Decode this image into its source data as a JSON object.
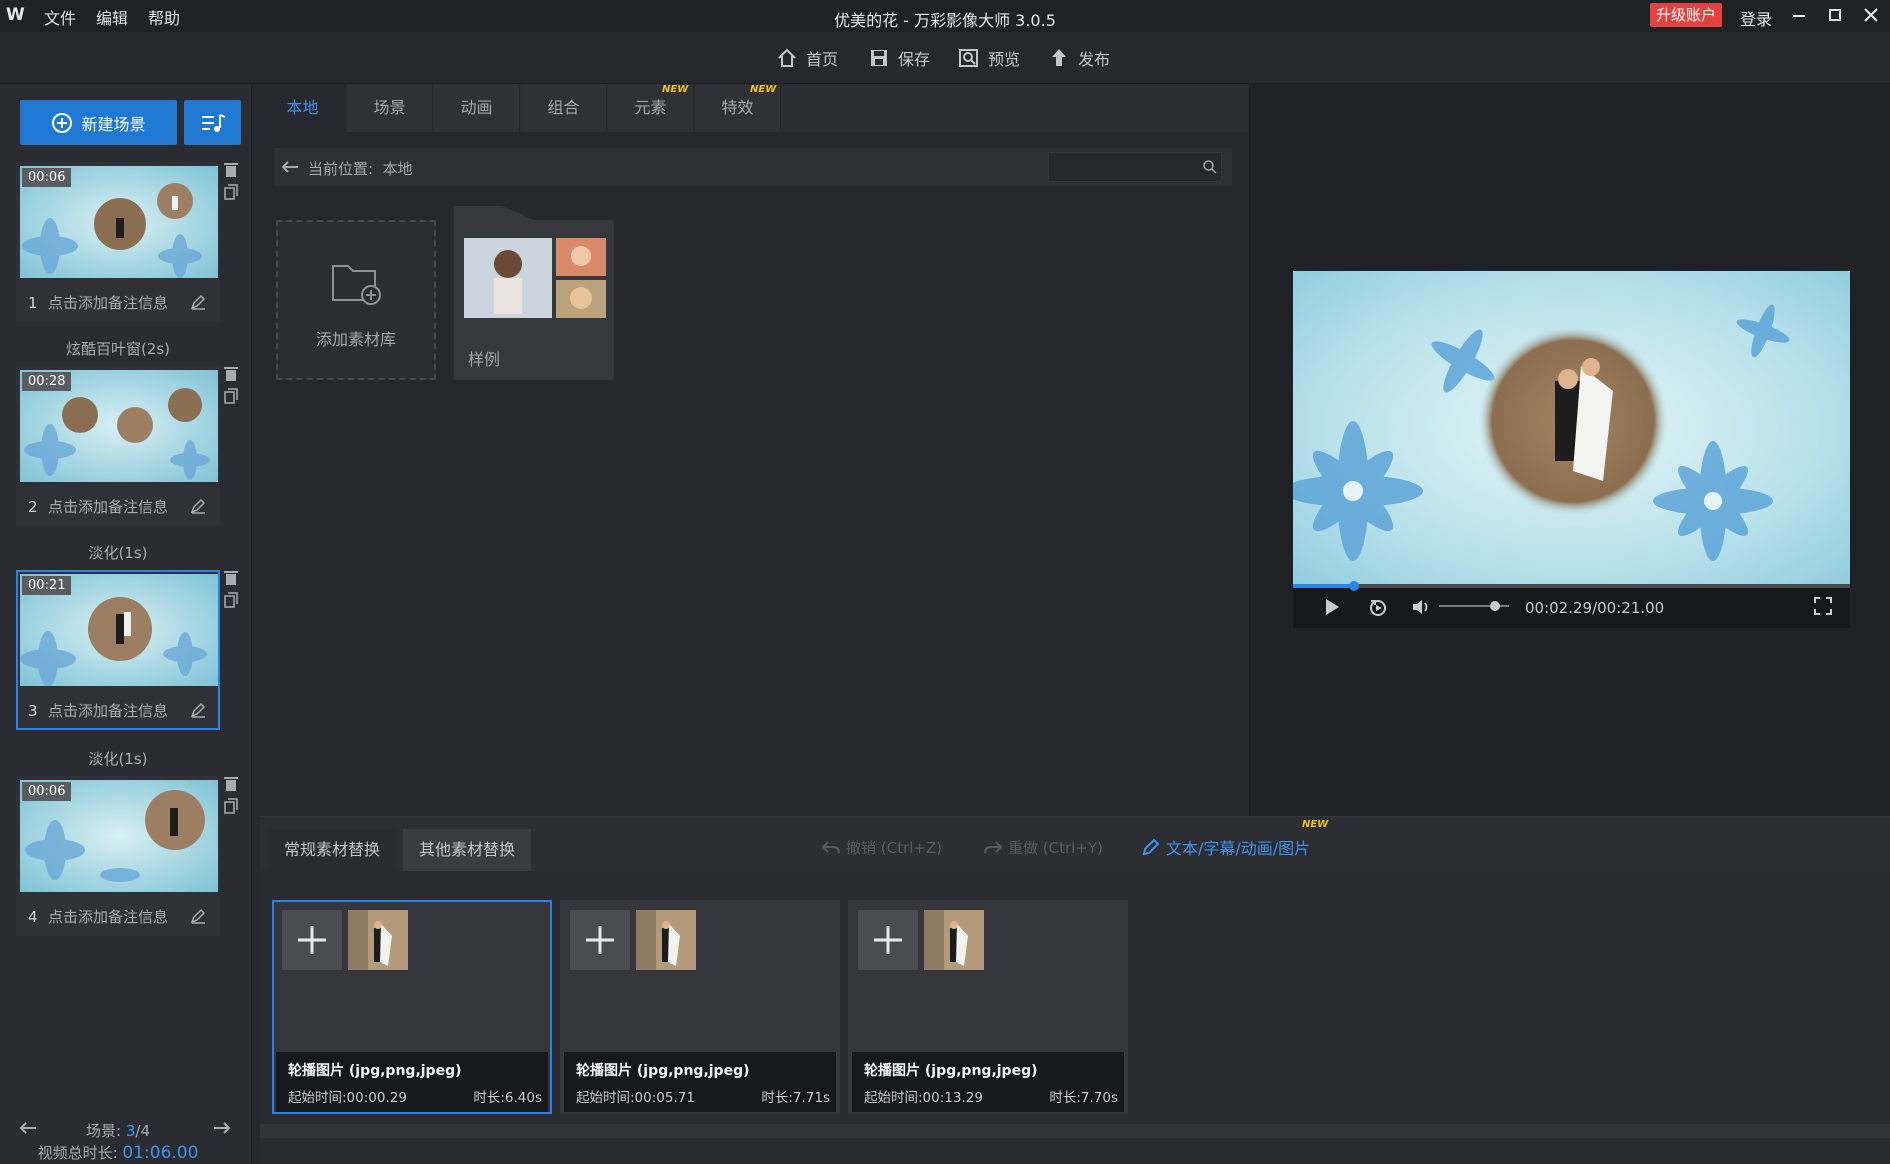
{
  "titlebar": {
    "logo_text": "W",
    "menu": [
      "文件",
      "编辑",
      "帮助"
    ],
    "title": "优美的花 - 万彩影像大师 3.0.5",
    "upgrade": "升级账户",
    "login": "登录"
  },
  "toolbar": {
    "home": "首页",
    "save": "保存",
    "preview": "预览",
    "publish": "发布"
  },
  "sidebar": {
    "new_scene": "新建场景",
    "scenes": [
      {
        "time": "00:06",
        "num": "1",
        "note": "点击添加备注信息"
      },
      {
        "time": "00:28",
        "num": "2",
        "note": "点击添加备注信息"
      },
      {
        "time": "00:21",
        "num": "3",
        "note": "点击添加备注信息"
      },
      {
        "time": "00:06",
        "num": "4",
        "note": "点击添加备注信息"
      }
    ],
    "transitions": [
      "炫酷百叶窗(2s)",
      "淡化(1s)",
      "淡化(1s)"
    ],
    "counter_label": "场景:",
    "counter_current": "3",
    "counter_total": "/4",
    "total_label": "视频总时长:",
    "total_value": "01:06.00",
    "selected_scene": 3
  },
  "library": {
    "tabs": [
      "本地",
      "场景",
      "动画",
      "组合",
      "元素",
      "特效"
    ],
    "new_badge": "NEW",
    "location_label": "当前位置:",
    "location_value": "本地",
    "search_placeholder": "",
    "add_library": "添加素材库",
    "sample_folder": "样例"
  },
  "player": {
    "time": "00:02.29/00:21.00",
    "progress": 0.109,
    "volume": 0.8
  },
  "replace": {
    "tabs": [
      "常规素材替换",
      "其他素材替换"
    ],
    "undo": "撤销 (Ctrl+Z)",
    "redo": "重做 (Ctrl+Y)",
    "text_edit": "文本/字幕/动画/图片",
    "new_badge": "NEW",
    "slots": [
      {
        "title": "轮播图片 (jpg,png,jpeg)",
        "start": "起始时间:00:00.29",
        "duration": "时长:6.40s"
      },
      {
        "title": "轮播图片 (jpg,png,jpeg)",
        "start": "起始时间:00:05.71",
        "duration": "时长:7.71s"
      },
      {
        "title": "轮播图片 (jpg,png,jpeg)",
        "start": "起始时间:00:13.29",
        "duration": "时长:7.70s"
      }
    ]
  },
  "colors": {
    "accent": "#2a84e6",
    "upgrade": "#e5413e",
    "new_badge": "#f0c419"
  }
}
